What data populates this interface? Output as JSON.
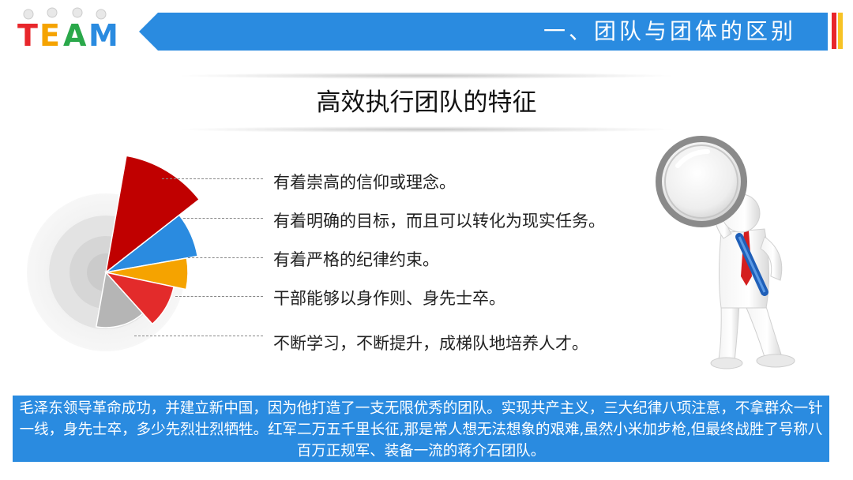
{
  "logo": {
    "text": "TEAM"
  },
  "header": {
    "title": "一、团队与团体的区别"
  },
  "subtitle": "高效执行团队的特征",
  "features": [
    "有着崇高的信仰或理念。",
    "有着明确的目标，而且可以转化为现实任务。",
    "有着严格的纪律约束。",
    "干部能够以身作则、身先士卒。",
    "不断学习，不断提升，成梯队地培养人才。"
  ],
  "bottom_text": "毛泽东领导革命成功，并建立新中国，因为他打造了一支无限优秀的团队。实现共产主义，三大纪律八项注意，不拿群众一针一线，身先士卒，多少先烈壮烈牺牲。红军二万五千里长征,那是常人想无法想象的艰难,虽然小米加步枪,但最终战胜了号称八百万正规军、装备一流的蒋介石团队。",
  "colors": {
    "header_blue": "#2a8be0",
    "accent_yellow": "#f7c325",
    "accent_red": "#e8262b",
    "slice_red": "#c00000",
    "slice_blue": "#2a8be0",
    "slice_orange": "#f5a300",
    "slice_light_red": "#e32b2b",
    "slice_gray": "#b5b5b5"
  }
}
